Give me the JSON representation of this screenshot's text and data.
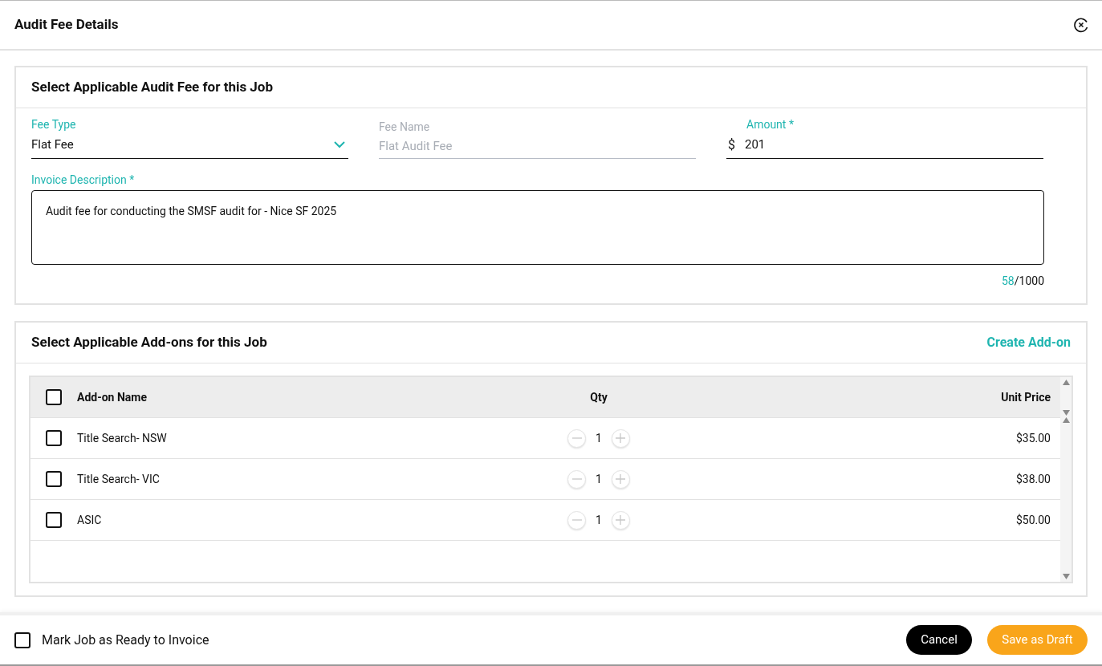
{
  "dialog": {
    "title": "Audit Fee Details"
  },
  "fee_section": {
    "title": "Select Applicable Audit Fee for this Job",
    "fee_type": {
      "label": "Fee Type",
      "value": "Flat Fee"
    },
    "fee_name": {
      "label": "Fee Name",
      "value": "Flat Audit Fee",
      "disabled": true
    },
    "amount": {
      "label": "Amount *",
      "prefix": "$",
      "value": "201"
    },
    "invoice_description": {
      "label": "Invoice Description *",
      "value": "Audit fee for conducting the SMSF audit for - Nice SF 2025",
      "count": "58",
      "limit": "/1000"
    }
  },
  "addons_section": {
    "title": "Select Applicable Add-ons for this Job",
    "create_link": "Create Add-on",
    "table": {
      "select_all_checked": false,
      "columns": [
        "Add-on Name",
        "Qty",
        "Unit Price"
      ],
      "rows": [
        {
          "checked": false,
          "name": "Title Search- NSW",
          "qty": "1",
          "unit_price": "$35.00"
        },
        {
          "checked": false,
          "name": "Title Search- VIC",
          "qty": "1",
          "unit_price": "$38.00"
        },
        {
          "checked": false,
          "name": "ASIC",
          "qty": "1",
          "unit_price": "$50.00"
        }
      ]
    }
  },
  "footer": {
    "ready_to_invoice": {
      "label": "Mark Job as Ready to Invoice",
      "checked": false
    },
    "buttons": [
      {
        "kind": "secondary",
        "label": "Cancel"
      },
      {
        "kind": "primary",
        "label": "Save as Draft"
      }
    ]
  }
}
